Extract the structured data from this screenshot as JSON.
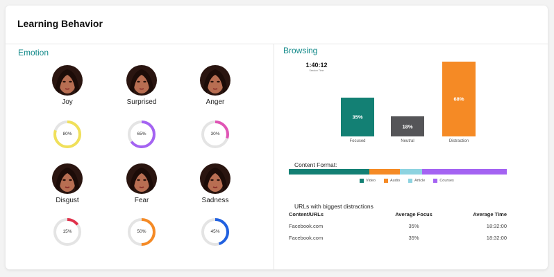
{
  "header": {
    "title": "Learning Behavior"
  },
  "emotion": {
    "title": "Emotion",
    "items": [
      {
        "label": "Joy",
        "percent": 80,
        "percent_label": "80%",
        "color": "#f0e05a"
      },
      {
        "label": "Surprised",
        "percent": 65,
        "percent_label": "65%",
        "color": "#a463f2"
      },
      {
        "label": "Anger",
        "percent": 30,
        "percent_label": "30%",
        "color": "#e055b5"
      },
      {
        "label": "Disgust",
        "percent": 15,
        "percent_label": "15%",
        "color": "#e0304a"
      },
      {
        "label": "Fear",
        "percent": 50,
        "percent_label": "50%",
        "color": "#f58a25"
      },
      {
        "label": "Sadness",
        "percent": 45,
        "percent_label": "45%",
        "color": "#2060e0"
      }
    ]
  },
  "browsing": {
    "title": "Browsing",
    "session_time": "1:40:12",
    "session_label": "Session Time",
    "chart_data": {
      "type": "bar",
      "categories": [
        "Focused",
        "Neutral",
        "Distraction"
      ],
      "values": [
        35,
        18,
        68
      ],
      "value_labels": [
        "35%",
        "18%",
        "68%"
      ],
      "colors": [
        "#138074",
        "#555558",
        "#f58a25"
      ]
    }
  },
  "content_format": {
    "title": "Content Format:",
    "segments": [
      {
        "name": "Video",
        "share": 37,
        "color": "#138074"
      },
      {
        "name": "Audio",
        "share": 14,
        "color": "#f58a25"
      },
      {
        "name": "Article",
        "share": 10,
        "color": "#8dd3e0"
      },
      {
        "name": "Courses",
        "share": 39,
        "color": "#a463f2"
      }
    ]
  },
  "urls": {
    "title": "URLs with biggest distractions",
    "columns": [
      "Content/URLs",
      "Average Focus",
      "Average Time"
    ],
    "rows": [
      [
        "Facebook.com",
        "35%",
        "18:32:00"
      ],
      [
        "Facebook.com",
        "35%",
        "18:32:00"
      ]
    ]
  }
}
